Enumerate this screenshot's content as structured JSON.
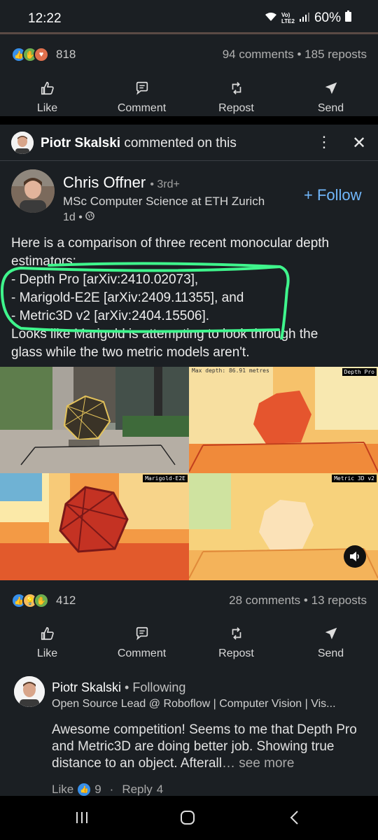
{
  "status_bar": {
    "time": "12:22",
    "network_label_top": "Vo)",
    "network_label_bottom": "LTE2",
    "battery": "60%"
  },
  "prev_post": {
    "reactions_count": "818",
    "comments": "94 comments",
    "reposts": "185 reposts"
  },
  "actions": {
    "like": "Like",
    "comment": "Comment",
    "repost": "Repost",
    "send": "Send"
  },
  "comment_context": {
    "name": "Piotr Skalski",
    "text": "commented on this"
  },
  "author": {
    "name": "Chris Offner",
    "degree": "• 3rd+",
    "title": "MSc Computer Science at ETH Zurich",
    "time": "1d •",
    "follow": "+ Follow"
  },
  "post": {
    "lines": [
      "Here is a comparison of three recent monocular depth",
      "estimators:",
      "- Depth Pro [arXiv:2410.02073],",
      "- Marigold-E2E [arXiv:2409.11355], and",
      "- Metric3D v2 [arXiv:2404.15506].",
      "Looks like Marigold is attempting to look through the",
      "glass while the two metric models aren't."
    ]
  },
  "media": {
    "max_depth": "Max depth: 86.91 metres",
    "label_depth_pro": "Depth Pro",
    "label_marigold": "Marigold-E2E",
    "label_metric3d": "Metric 3D v2"
  },
  "post_stats": {
    "reactions_count": "412",
    "comments": "28 comments",
    "reposts": "13 reposts"
  },
  "reply": {
    "name": "Piotr Skalski",
    "following": "• Following",
    "headline": "Open Source Lead @ Roboflow | Computer Vision | Vis...",
    "body": "Awesome competition! Seems to me that Depth Pro and Metric3D are doing better job. Showing true distance to an object. Afterall",
    "see_more": "… see more",
    "like_label": "Like",
    "like_count": "9",
    "reply_label": "Reply",
    "reply_count": "4"
  },
  "colors": {
    "background": "#1b1f23",
    "accent_blue": "#71b7fb",
    "highlight_green": "#3ff58c"
  },
  "icons": [
    "wifi-icon",
    "signal-icon",
    "battery-icon",
    "like-icon",
    "comment-icon",
    "repost-icon",
    "send-icon",
    "more-icon",
    "close-icon",
    "globe-icon",
    "sound-icon",
    "recent-apps-icon",
    "home-icon",
    "back-icon"
  ]
}
